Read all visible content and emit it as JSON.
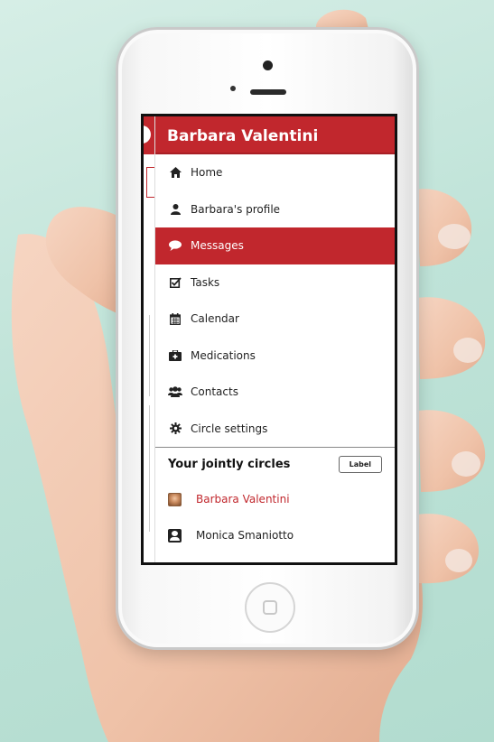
{
  "header": {
    "user_name": "Barbara Valentini"
  },
  "menu": {
    "items": [
      {
        "label": "Home",
        "icon": "home-icon",
        "active": false
      },
      {
        "label": "Barbara's profile",
        "icon": "user-icon",
        "active": false
      },
      {
        "label": "Messages",
        "icon": "speech-bubble-icon",
        "active": true
      },
      {
        "label": "Tasks",
        "icon": "checkbox-icon",
        "active": false
      },
      {
        "label": "Calendar",
        "icon": "calendar-icon",
        "active": false
      },
      {
        "label": "Medications",
        "icon": "medical-kit-icon",
        "active": false
      },
      {
        "label": "Contacts",
        "icon": "group-icon",
        "active": false
      },
      {
        "label": "Circle settings",
        "icon": "gear-icon",
        "active": false
      }
    ]
  },
  "circles": {
    "title": "Your jointly circles",
    "label_button": "Label",
    "items": [
      {
        "name": "Barbara Valentini",
        "avatar": "photo-avatar",
        "highlighted": true
      },
      {
        "name": "Monica Smaniotto",
        "avatar": "generic-avatar",
        "highlighted": false
      }
    ]
  },
  "colors": {
    "accent": "#c1272d",
    "background": "#bfe3d8"
  }
}
